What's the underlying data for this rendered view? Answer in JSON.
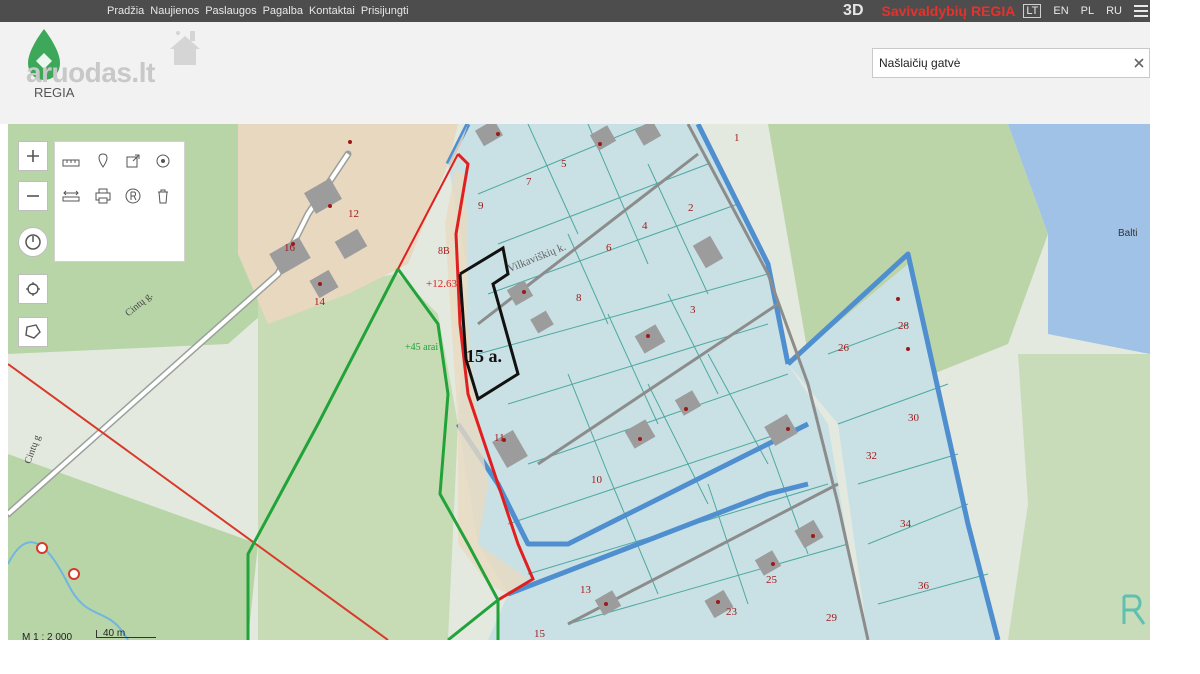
{
  "nav": {
    "items": [
      "Pradžia",
      "Naujienos",
      "Paslaugos",
      "Pagalba",
      "Kontaktai",
      "Prisijungti"
    ],
    "three_d": "3D",
    "brand": "Savivaldybių REGIA",
    "langs": [
      "LT",
      "EN",
      "PL",
      "RU"
    ],
    "active_lang": "LT"
  },
  "header": {
    "logo_text": "aruodas.lt",
    "logo_sub": "REGIA",
    "search_value": "Našlaičių gatvė"
  },
  "map": {
    "area_label": "15 a.",
    "street_labels": [
      "Cintų g.",
      "Cintų g",
      "Vilkaviškių k."
    ],
    "annotations": [
      "+12.63",
      "+45 arai",
      "8B"
    ],
    "parcels": [
      "1",
      "2",
      "3",
      "4",
      "5",
      "6",
      "7",
      "8",
      "9",
      "10",
      "11",
      "12",
      "13",
      "14",
      "15",
      "16",
      "23",
      "25",
      "26",
      "28",
      "29",
      "30",
      "32",
      "34",
      "36"
    ],
    "edge_text": "Balti",
    "scale_text": "M 1 : 2 000",
    "scale_bar": "40 m"
  },
  "colors": {
    "topbar": "#4d4d4d",
    "brand": "#e8312a",
    "parcel_fill": "#c9e1e4",
    "parcel_border": "#4f8fd0",
    "red_boundary": "#e02020",
    "green_boundary": "#21a33a",
    "black_outline": "#111111",
    "lake": "#9fc2e6"
  }
}
